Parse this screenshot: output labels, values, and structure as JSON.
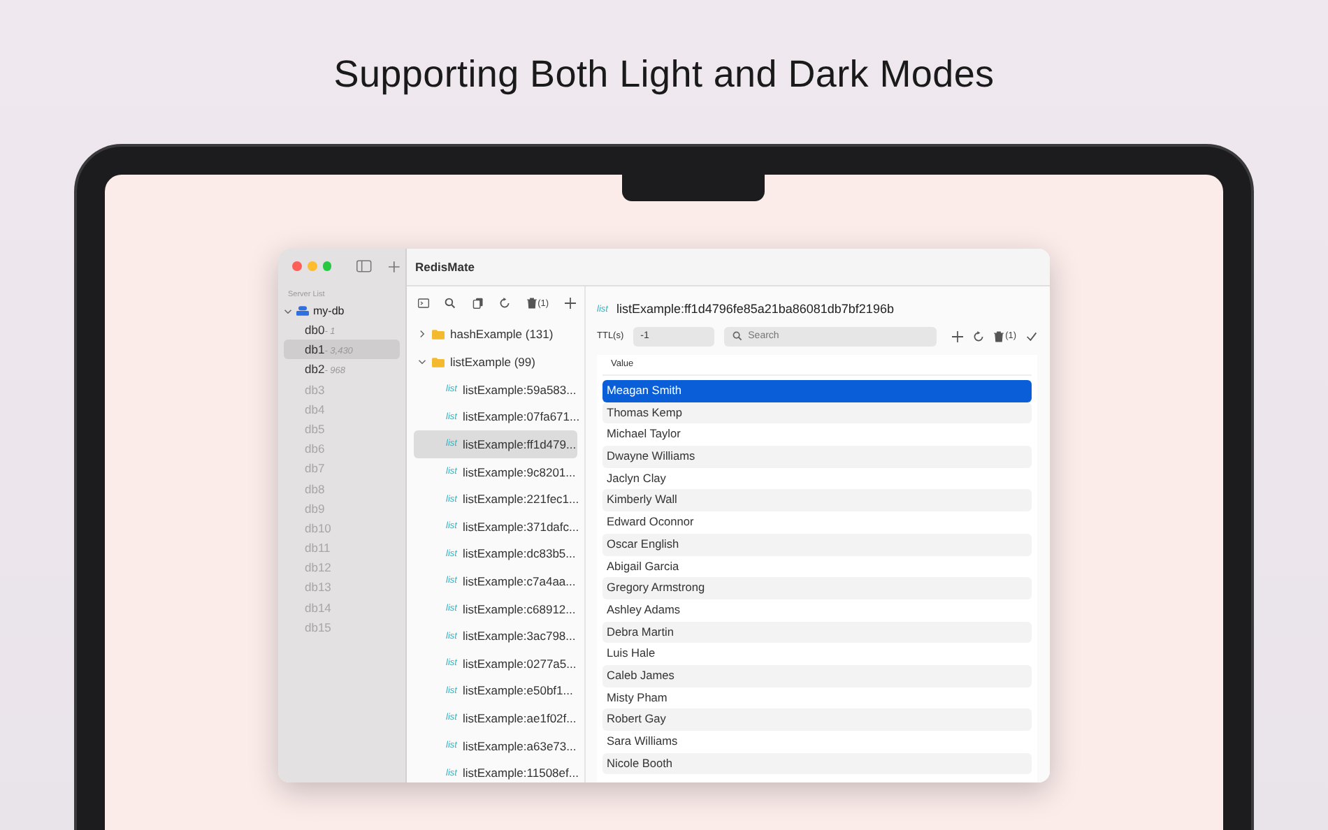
{
  "headline": "Supporting Both Light and Dark Modes",
  "window": {
    "title": "RedisMate"
  },
  "sidebar": {
    "section_label": "Server List",
    "server": {
      "name": "my-db",
      "expanded": true
    },
    "databases": [
      {
        "name": "db0",
        "count": "- 1",
        "disabled": false,
        "selected": false
      },
      {
        "name": "db1",
        "count": "- 3,430",
        "disabled": false,
        "selected": true
      },
      {
        "name": "db2",
        "count": "- 968",
        "disabled": false,
        "selected": false
      },
      {
        "name": "db3",
        "disabled": true,
        "selected": false
      },
      {
        "name": "db4",
        "disabled": true,
        "selected": false
      },
      {
        "name": "db5",
        "disabled": true,
        "selected": false
      },
      {
        "name": "db6",
        "disabled": true,
        "selected": false
      },
      {
        "name": "db7",
        "disabled": true,
        "selected": false
      },
      {
        "name": "db8",
        "disabled": true,
        "selected": false
      },
      {
        "name": "db9",
        "disabled": true,
        "selected": false
      },
      {
        "name": "db10",
        "disabled": true,
        "selected": false
      },
      {
        "name": "db11",
        "disabled": true,
        "selected": false
      },
      {
        "name": "db12",
        "disabled": true,
        "selected": false
      },
      {
        "name": "db13",
        "disabled": true,
        "selected": false
      },
      {
        "name": "db14",
        "disabled": true,
        "selected": false
      },
      {
        "name": "db15",
        "disabled": true,
        "selected": false
      }
    ]
  },
  "key_toolbar": {
    "delete_count": "(1)"
  },
  "key_tree": [
    {
      "kind": "folder",
      "label": "hashExample (131)",
      "expanded": false
    },
    {
      "kind": "folder",
      "label": "listExample (99)",
      "expanded": true,
      "children": [
        {
          "kind": "key",
          "type": "list",
          "label": "listExample:59a583...",
          "selected": false
        },
        {
          "kind": "key",
          "type": "list",
          "label": "listExample:07fa671...",
          "selected": false
        },
        {
          "kind": "key",
          "type": "list",
          "label": "listExample:ff1d479...",
          "selected": true
        },
        {
          "kind": "key",
          "type": "list",
          "label": "listExample:9c8201...",
          "selected": false
        },
        {
          "kind": "key",
          "type": "list",
          "label": "listExample:221fec1...",
          "selected": false
        },
        {
          "kind": "key",
          "type": "list",
          "label": "listExample:371dafc...",
          "selected": false
        },
        {
          "kind": "key",
          "type": "list",
          "label": "listExample:dc83b5...",
          "selected": false
        },
        {
          "kind": "key",
          "type": "list",
          "label": "listExample:c7a4aa...",
          "selected": false
        },
        {
          "kind": "key",
          "type": "list",
          "label": "listExample:c68912...",
          "selected": false
        },
        {
          "kind": "key",
          "type": "list",
          "label": "listExample:3ac798...",
          "selected": false
        },
        {
          "kind": "key",
          "type": "list",
          "label": "listExample:0277a5...",
          "selected": false
        },
        {
          "kind": "key",
          "type": "list",
          "label": "listExample:e50bf1...",
          "selected": false
        },
        {
          "kind": "key",
          "type": "list",
          "label": "listExample:ae1f02f...",
          "selected": false
        },
        {
          "kind": "key",
          "type": "list",
          "label": "listExample:a63e73...",
          "selected": false
        },
        {
          "kind": "key",
          "type": "list",
          "label": "listExample:11508ef...",
          "selected": false
        }
      ]
    }
  ],
  "detail": {
    "type": "list",
    "key": "listExample:ff1d4796fe85a21ba86081db7bf2196b",
    "ttl_label": "TTL(s)",
    "ttl_value": "-1",
    "search_placeholder": "Search",
    "delete_count": "(1)",
    "column": "Value",
    "rows": [
      {
        "value": "Meagan Smith",
        "selected": true
      },
      {
        "value": "Thomas Kemp",
        "selected": false
      },
      {
        "value": "Michael Taylor",
        "selected": false
      },
      {
        "value": "Dwayne Williams",
        "selected": false
      },
      {
        "value": "Jaclyn Clay",
        "selected": false
      },
      {
        "value": "Kimberly Wall",
        "selected": false
      },
      {
        "value": "Edward Oconnor",
        "selected": false
      },
      {
        "value": "Oscar English",
        "selected": false
      },
      {
        "value": "Abigail Garcia",
        "selected": false
      },
      {
        "value": "Gregory Armstrong",
        "selected": false
      },
      {
        "value": "Ashley Adams",
        "selected": false
      },
      {
        "value": "Debra Martin",
        "selected": false
      },
      {
        "value": "Luis Hale",
        "selected": false
      },
      {
        "value": "Caleb James",
        "selected": false
      },
      {
        "value": "Misty Pham",
        "selected": false
      },
      {
        "value": "Robert Gay",
        "selected": false
      },
      {
        "value": "Sara Williams",
        "selected": false
      },
      {
        "value": "Nicole Booth",
        "selected": false
      }
    ]
  }
}
